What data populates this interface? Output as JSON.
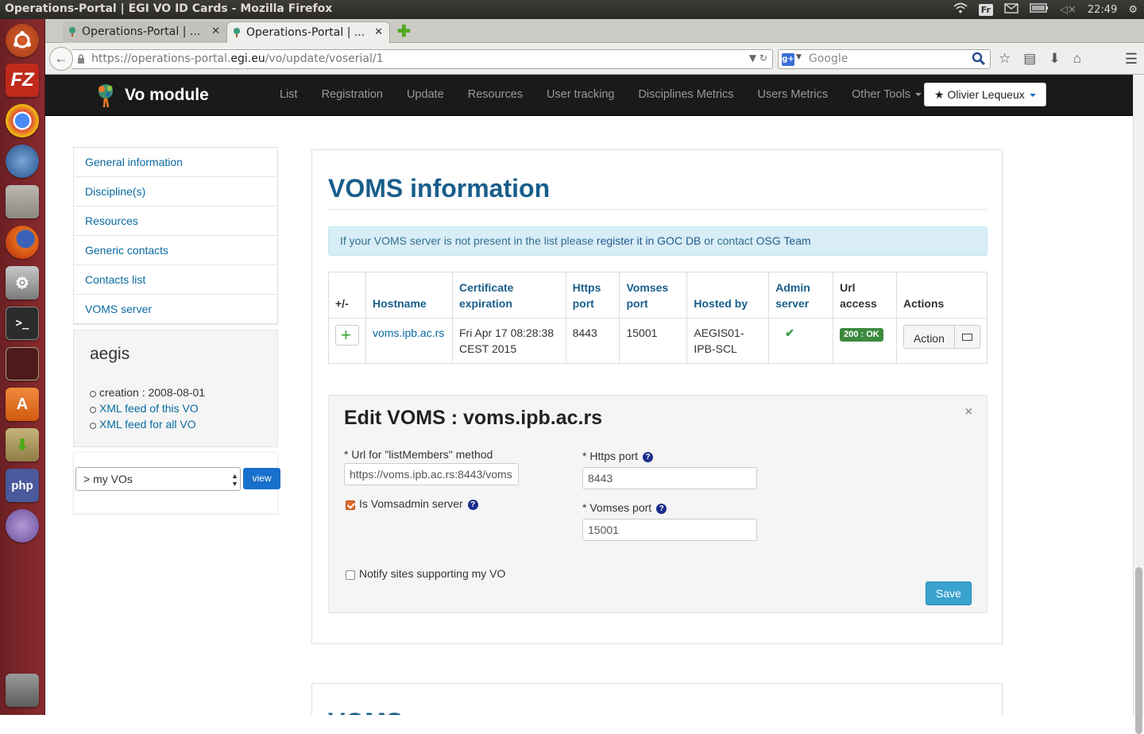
{
  "os": {
    "window_title": "Operations-Portal | EGI VO ID Cards - Mozilla Firefox",
    "keyboard_layout": "Fr",
    "clock": "22:49"
  },
  "browser": {
    "tabs": [
      {
        "label": "Operations-Portal | ...",
        "active": false
      },
      {
        "label": "Operations-Portal | ...",
        "active": true
      }
    ],
    "url_prefix": "https://operations-portal.",
    "url_domain": "egi.eu",
    "url_path": "/vo/update/voserial/1",
    "search_placeholder": "Google"
  },
  "site": {
    "brand": "Vo module",
    "nav": [
      "List",
      "Registration",
      "Update",
      "Resources",
      "User tracking",
      "Disciplines Metrics",
      "Users Metrics"
    ],
    "other_tools": "Other Tools",
    "user": "Olivier Lequeux"
  },
  "sidebar": {
    "menu": [
      "General information",
      "Discipline(s)",
      "Resources",
      "Generic contacts",
      "Contacts list",
      "VOMS server"
    ],
    "vo_name": "aegis",
    "creation": "creation : 2008-08-01",
    "feed_this": "XML feed of this VO",
    "feed_all": "XML feed for all VO",
    "select_value": "> my VOs",
    "view_label": "view"
  },
  "main": {
    "title": "VOMS information",
    "alert_pre": "If your VOMS server is not present in the list please ",
    "alert_link1": "register it in GOC DB",
    "alert_mid": " or contact ",
    "alert_link2": "OSG Team",
    "table": {
      "headers": [
        "+/-",
        "Hostname",
        "Certificate expiration",
        "Https port",
        "Vomses port",
        "Hosted by",
        "Admin server",
        "Url access",
        "Actions"
      ],
      "row": {
        "hostname": "voms.ipb.ac.rs",
        "cert_expiration": "Fri Apr 17 08:28:38 CEST 2015",
        "https_port": "8443",
        "vomses_port": "15001",
        "hosted_by": "AEGIS01-IPB-SCL",
        "admin_server": "✔",
        "url_access": "200 : OK",
        "action_label": "Action"
      }
    },
    "edit": {
      "title": "Edit VOMS : voms.ipb.ac.rs",
      "close": "×",
      "url_label": "* Url for \"listMembers\" method",
      "url_value": "https://voms.ipb.ac.rs:8443/voms",
      "is_admin_label": "Is Vomsadmin server",
      "is_admin_checked": true,
      "notify_label": "Notify sites supporting my VO",
      "notify_checked": false,
      "https_label": "* Https port",
      "https_value": "8443",
      "vomses_label": "* Vomses port",
      "vomses_value": "15001",
      "save": "Save"
    },
    "next_section_title": "VOMS"
  }
}
